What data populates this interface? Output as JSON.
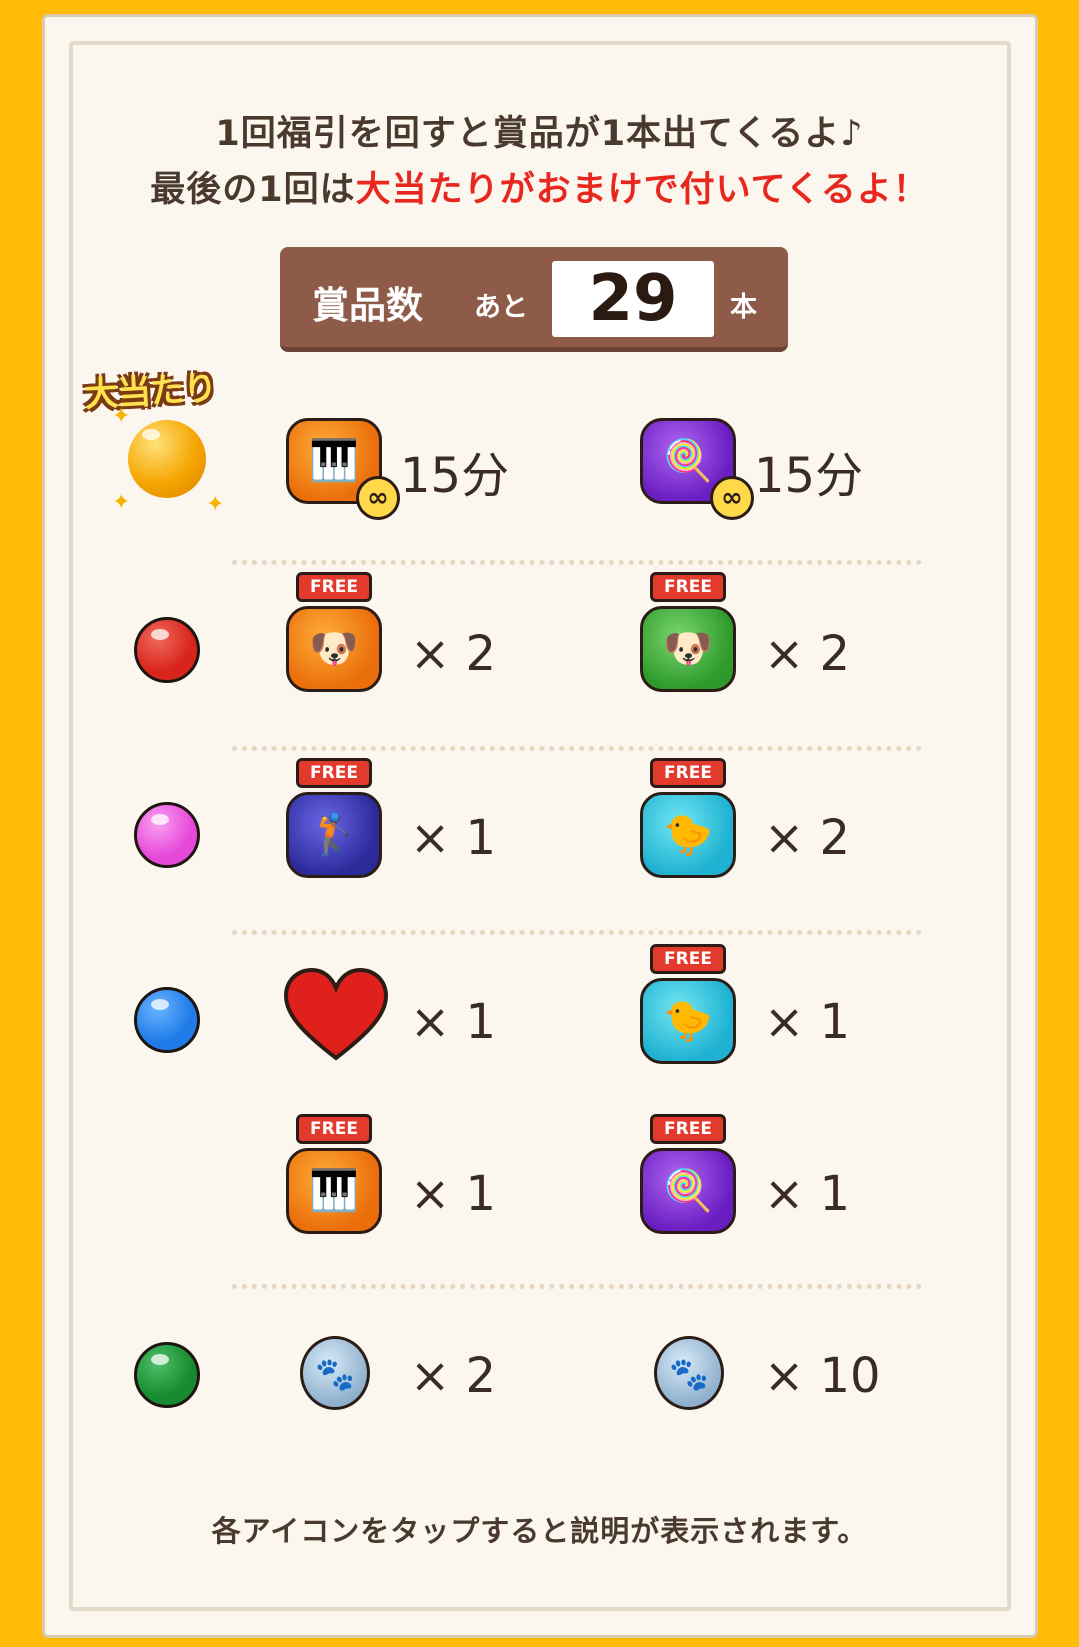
{
  "intro": {
    "line1": "1回福引を回すと賞品が1本出てくるよ♪",
    "line2_prefix": "最後の1回は",
    "line2_highlight": "大当たりがおまけで付いてくるよ！"
  },
  "counter": {
    "label": "賞品数",
    "sub": "あと",
    "value": "29",
    "unit": "本"
  },
  "jackpot_badge": "大当たり",
  "tiers": [
    {
      "ball": "gold",
      "prizes": [
        {
          "icon": "orange-jar-infinity-icon",
          "text": "15分"
        },
        {
          "icon": "purple-jar-infinity-icon",
          "text": "15分"
        }
      ]
    },
    {
      "ball": "red",
      "prizes": [
        {
          "icon": "orange-free-jar-icon",
          "tag": "FREE",
          "text": "× 2"
        },
        {
          "icon": "green-free-jar-icon",
          "tag": "FREE",
          "text": "× 2"
        }
      ]
    },
    {
      "ball": "pink",
      "prizes": [
        {
          "icon": "indigo-free-jar-icon",
          "tag": "FREE",
          "text": "× 1"
        },
        {
          "icon": "cyan-free-jar-icon",
          "tag": "FREE",
          "text": "× 2"
        }
      ]
    },
    {
      "ball": "blue",
      "prizes": [
        {
          "icon": "heart-icon",
          "text": "× 1"
        },
        {
          "icon": "cyan-free-jar-icon",
          "tag": "FREE",
          "text": "× 1"
        },
        {
          "icon": "orange-free-jar-icon",
          "tag": "FREE",
          "text": "× 1"
        },
        {
          "icon": "purple-free-jar-icon",
          "tag": "FREE",
          "text": "× 1"
        }
      ]
    },
    {
      "ball": "green",
      "prizes": [
        {
          "icon": "paw-coin-icon",
          "text": "× 2"
        },
        {
          "icon": "paw-coin-icon",
          "text": "× 10"
        }
      ]
    }
  ],
  "footer_note": "各アイコンをタップすると説明が表示されます。",
  "colors": {
    "background": "#FFBB05",
    "panel": "#FBF7EE",
    "counter": "#8E5B49",
    "highlight": "#E8281E"
  }
}
